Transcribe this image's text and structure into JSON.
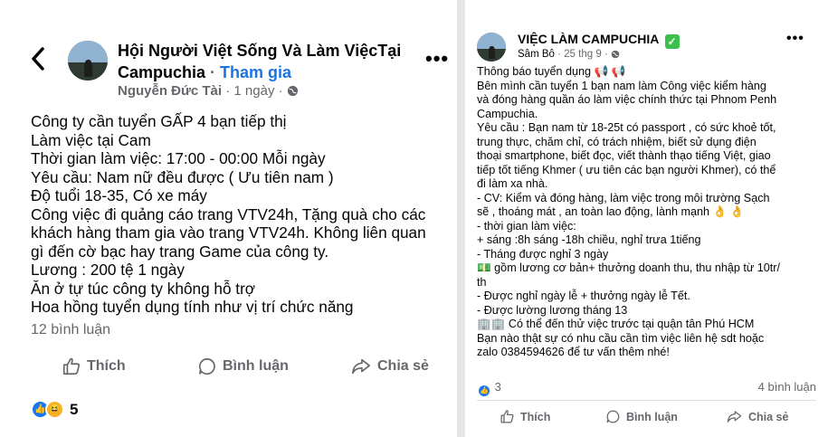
{
  "left_post": {
    "back_glyph": "‹",
    "group_name": "Hội Người Việt Sống Và Làm ViệcTại Campuchia",
    "join_label": "Tham gia",
    "author": "Nguyễn Đức Tài",
    "time": "1 ngày",
    "more_glyph": "•••",
    "body_lines": [
      "Công ty cần tuyển GẤP 4 bạn tiếp thị",
      "Làm việc tại Cam",
      "Thời gian làm việc: 17:00 - 00:00 Mỗi ngày",
      "Yêu cầu: Nam nữ đều được ( Ưu tiên nam )",
      "Độ tuổi 18-35, Có xe máy",
      "Công việc đi quảng cáo trang VTV24h, Tặng quà cho các",
      "khách hàng tham gia vào trang VTV24h. Không  liên quan",
      "gì đến cờ bạc hay trang Game của công ty.",
      "Lương : 200 tệ 1 ngày",
      "Ăn ở tự túc công ty không hỗ trợ",
      "Hoa hồng tuyển dụng tính như vị trí chức năng"
    ],
    "comments_count": "12 bình luận",
    "actions": {
      "like": "Thích",
      "comment": "Bình luận",
      "share": "Chia sẻ"
    },
    "reaction_count": "5"
  },
  "right_post": {
    "group_name": "VIỆC LÀM CAMPUCHIA",
    "author": "Sâm Bô",
    "time": "25 thg 9",
    "more_glyph": "•••",
    "body_lines": [
      "Thông báo tuyển dụng 📢 📢",
      "Bên mình cần tuyển 1 bạn nam làm  Công việc kiểm hàng",
      "và đóng hàng quần áo làm việc chính thức tại Phnom Penh",
      "Campuchia.",
      "Yêu cầu : Bạn nam từ 18-25t có passport ,  có sức khoẻ tốt,",
      "trung thực, chăm chỉ, có trách nhiệm, biết sử dụng điện",
      "thoại smartphone, biết đọc, viết thành thạo tiếng Việt, giao",
      "tiếp tốt tiếng Khmer ( ưu tiên các bạn người Khmer), có thể",
      "đi làm xa nhà.",
      "- CV: Kiểm và đóng hàng, làm việc trong môi trường Sạch",
      "sẽ , thoáng mát , an toàn lao động, lành mạnh 👌 👌",
      "- thời gian làm việc:",
      "+ sáng :8h sáng -18h chiều, nghỉ trưa 1tiếng",
      "- Tháng được nghỉ 3 ngày",
      "💵 gồm lương cơ bản+ thưởng doanh thu, thu nhập từ 10tr/",
      "th",
      "-  Được nghỉ ngày lễ + thưởng ngày lễ Tết.",
      "- Được lường lương tháng 13",
      "🏢🏢 Có thể đến thử việc trước tại quận tân Phú HCM",
      "Bạn nào thật sự có nhu cầu cần tìm việc liên hệ sdt hoặc",
      "zalo 0384594626 để tư vấn thêm nhé!"
    ],
    "reaction_count": "3",
    "comments_count": "4 bình luận",
    "actions": {
      "like": "Thích",
      "comment": "Bình luận",
      "share": "Chia sẻ"
    }
  },
  "colors": {
    "accent": "#1b74e4",
    "muted": "#65676b",
    "like_blue": "#1877f2",
    "verified_green": "#3dbf4d",
    "divider": "#e6e6e6"
  },
  "icons": [
    "back-arrow-icon",
    "more-icon",
    "globe-icon",
    "thumbs-up-icon",
    "comment-bubble-icon",
    "share-arrow-icon",
    "verified-check-icon"
  ]
}
